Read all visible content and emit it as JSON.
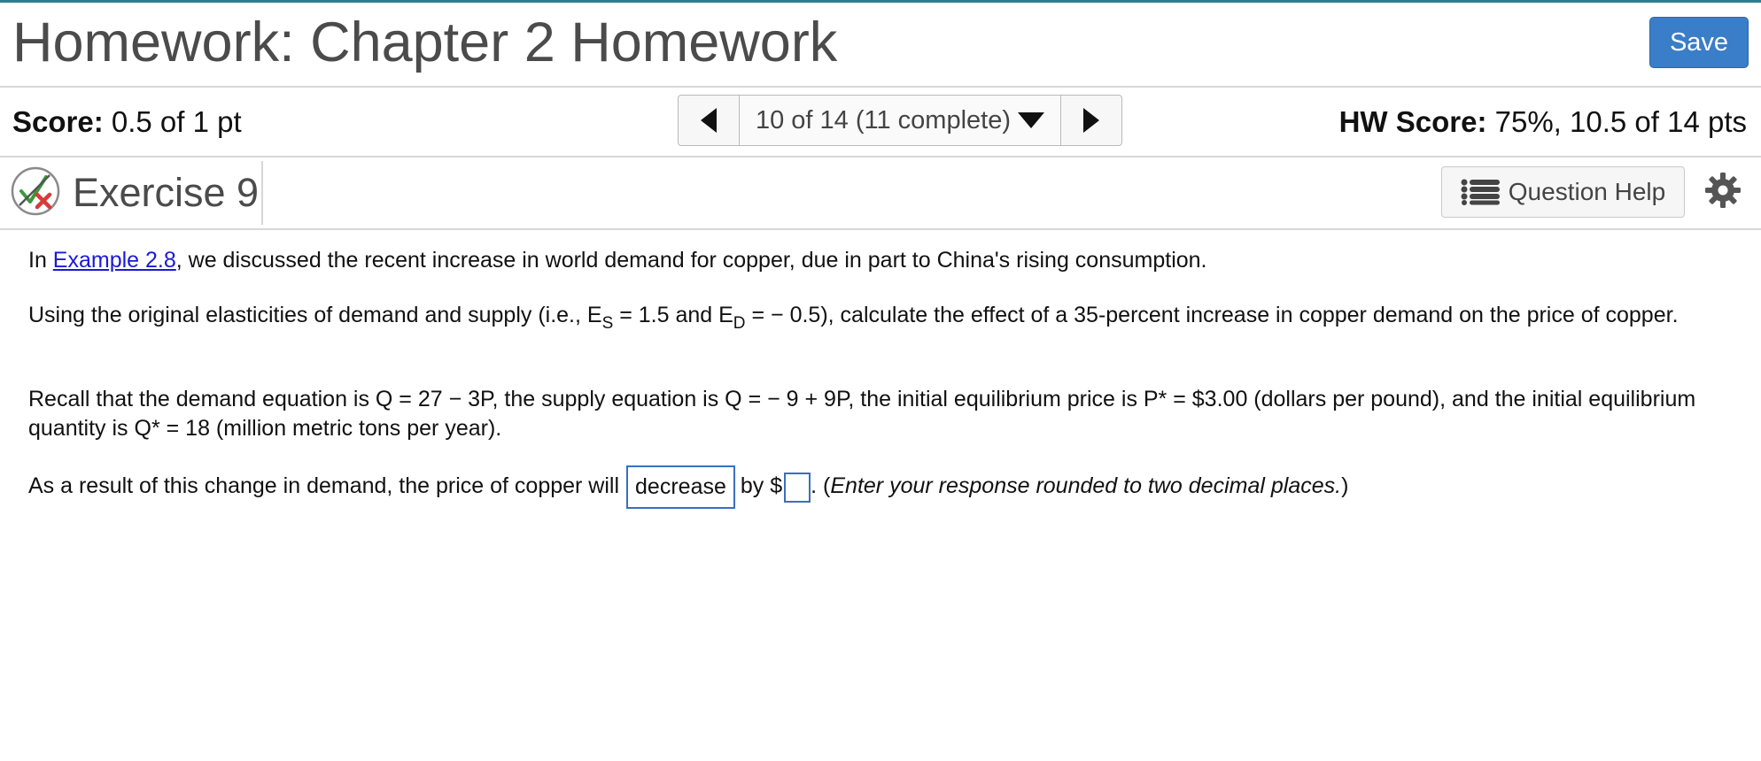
{
  "header": {
    "title": "Homework: Chapter 2 Homework",
    "save_label": "Save"
  },
  "scorebar": {
    "score_label": "Score:",
    "score_value": "0.5 of 1 pt",
    "nav_label": "10 of 14 (11 complete)",
    "hw_score_label": "HW Score:",
    "hw_score_value": "75%, 10.5 of 14 pts"
  },
  "exercise": {
    "title": "Exercise 9",
    "question_help_label": "Question Help"
  },
  "content": {
    "p1_prefix": "In ",
    "p1_link": "Example 2.8",
    "p1_suffix": ", we discussed the recent increase in world demand for copper, due in part to China's rising consumption.",
    "p2_a": "Using the original elasticities of demand and supply (i.e., E",
    "p2_sub_s": "S",
    "p2_b": " = 1.5 and E",
    "p2_sub_d": "D",
    "p2_c": " = − 0.5), calculate the effect of a 35-percent increase in copper demand on the price of copper.",
    "p3": "Recall that the demand equation is Q = 27 − 3P, the supply equation is Q = − 9 + 9P, the initial equilibrium price is P* = $3.00 (dollars per pound), and the initial equilibrium quantity is Q* = 18 (million metric tons per year).",
    "p4_prefix": "As a result of this change in demand, the price of copper will",
    "p4_selected": "decrease",
    "p4_mid": "by $",
    "p4_input_value": "",
    "p4_after_input": ". (",
    "p4_hint": "Enter your response rounded to two decimal places.",
    "p4_close": ")"
  },
  "colors": {
    "accent": "#3a7dc8",
    "top_line": "#2a7f8e",
    "link": "#1a1ad6"
  }
}
